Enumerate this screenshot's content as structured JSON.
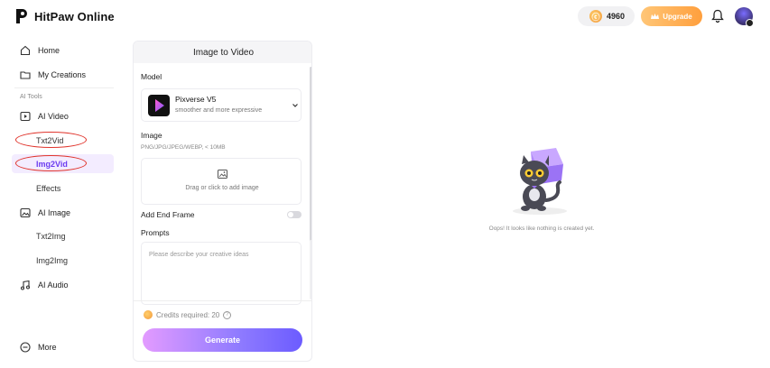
{
  "header": {
    "brand": "HitPaw Online",
    "credits": "4960",
    "upgrade_label": "Upgrade",
    "icons": [
      "logo-icon",
      "coin-icon",
      "crown-icon",
      "bell-icon",
      "avatar"
    ]
  },
  "sidebar": {
    "home": "Home",
    "my_creations": "My Creations",
    "section_label": "AI Tools",
    "ai_video": "AI Video",
    "txt2vid": "Txt2Vid",
    "img2vid": "Img2Vid",
    "effects": "Effects",
    "ai_image": "AI Image",
    "txt2img": "Txt2Img",
    "img2img": "Img2Img",
    "ai_audio": "AI Audio",
    "more": "More"
  },
  "panel": {
    "title": "Image to Video",
    "model_label": "Model",
    "model_name": "Pixverse V5",
    "model_desc": "smoother and more expressive",
    "image_label": "Image",
    "image_hint": "PNG/JPG/JPEG/WEBP, < 10MB",
    "upload_text": "Drag or click to add image",
    "end_frame_label": "Add End Frame",
    "end_frame_on": false,
    "prompts_label": "Prompts",
    "prompt_placeholder": "Please describe your creative ideas",
    "credits_required": "Credits required: 20",
    "generate_label": "Generate"
  },
  "empty_state": {
    "message": "Oops! It looks like nothing is created yet."
  },
  "colors": {
    "accent": "#6c3cf0",
    "upgrade": "#ff9f3d",
    "generate_start": "#e39bff",
    "generate_end": "#6c5cff",
    "annotation": "#e0342c"
  }
}
